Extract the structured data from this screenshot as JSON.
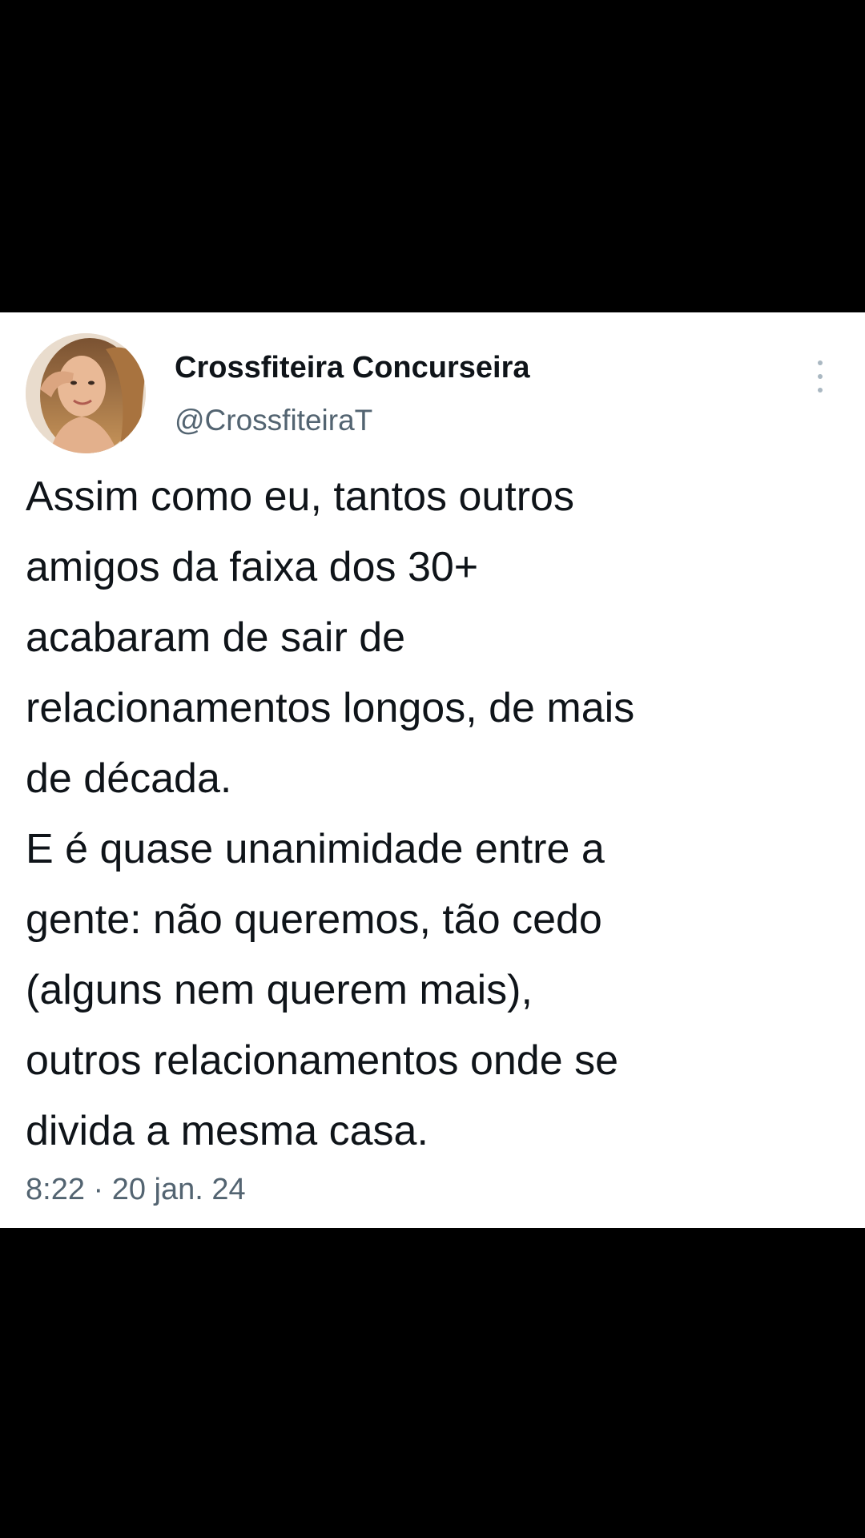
{
  "tweet": {
    "author": {
      "display_name": "Crossfiteira Concurseira",
      "handle": "@CrossfiteiraT"
    },
    "more_icon": "more-vertical-icon",
    "text_lines": [
      "Assim como eu, tantos outros",
      "amigos da faixa dos 30+",
      "acabaram de sair de",
      "relacionamentos longos, de mais",
      "de década.",
      "E é quase unanimidade entre a",
      "gente: não queremos, tão cedo",
      "(alguns nem querem mais),",
      "outros relacionamentos onde se",
      "divida a mesma casa."
    ],
    "timestamp": "8:22 · 20 jan. 24"
  },
  "colors": {
    "background": "#000000",
    "card": "#ffffff",
    "text_primary": "#0f1419",
    "text_secondary": "#536471"
  }
}
